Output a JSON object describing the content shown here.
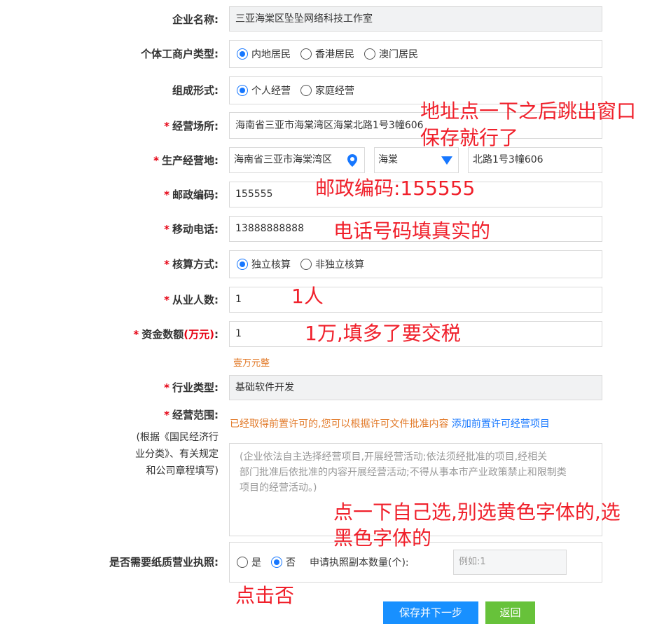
{
  "form": {
    "company_name": {
      "label": "企业名称:",
      "value": "三亚海棠区坠坠网络科技工作室"
    },
    "business_type": {
      "label": "个体工商户类型:",
      "options": [
        "内地居民",
        "香港居民",
        "澳门居民"
      ],
      "selected": 0
    },
    "composition": {
      "label": "组成形式:",
      "options": [
        "个人经营",
        "家庭经营"
      ],
      "selected": 0
    },
    "premises": {
      "label": "经营场所:",
      "value": "海南省三亚市海棠湾区海棠北路1号3幢606"
    },
    "production_site": {
      "label": "生产经营地:",
      "region": "海南省三亚市海棠湾区",
      "town": "海棠",
      "street": "北路1号3幢606"
    },
    "postal_code": {
      "label": "邮政编码:",
      "value": "155555"
    },
    "mobile": {
      "label": "移动电话:",
      "value": "13888888888"
    },
    "accounting": {
      "label": "核算方式:",
      "options": [
        "独立核算",
        "非独立核算"
      ],
      "selected": 0
    },
    "employees": {
      "label": "从业人数:",
      "value": "1"
    },
    "capital": {
      "label": "资金数额",
      "unit": "(万元)",
      "colon": ":",
      "value": "1",
      "hint": "壹万元整"
    },
    "industry": {
      "label": "行业类型:",
      "value": "基础软件开发"
    },
    "scope": {
      "label": "经营范围:",
      "note_lines": [
        "(根据《国民经济行",
        "业分类》、有关规定",
        "和公司章程填写)"
      ],
      "permit_hint": "已经取得前置许可的,您可以根据许可文件批准内容",
      "permit_link": "添加前置许可经营项目",
      "placeholder_lines": [
        "(企业依法自主选择经营项目,开展经营活动;依法须经批准的项目,经相关",
        "部门批准后依批准的内容开展经营活动;不得从事本市产业政策禁止和限制类",
        "项目的经营活动。)"
      ]
    },
    "paper_license": {
      "label": "是否需要纸质营业执照:",
      "options": [
        "是",
        "否"
      ],
      "selected": 1,
      "copies_label": "申请执照副本数量(个):",
      "copies_placeholder": "例如:1"
    }
  },
  "buttons": {
    "save_next": "保存并下一步",
    "back": "返回"
  },
  "annotations": {
    "address_1": "地址点一下之后跳出窗口",
    "address_2": "保存就行了",
    "postal": "邮政编码:155555",
    "phone": "电话号码填真实的",
    "employees": "1人",
    "capital": "1万,填多了要交税",
    "scope_1": "点一下自己选,别选黄色字体的,选",
    "scope_2": "黑色字体的",
    "paper": "点击否"
  },
  "colors": {
    "accent": "#1677ff",
    "save_button": "#1890ff",
    "back_button": "#67c23a",
    "annotation": "#f0202b",
    "required": "#e60012",
    "hint": "#e27a29"
  },
  "icons": {
    "location": "location-pin-icon",
    "dropdown": "triangle-down-icon"
  }
}
